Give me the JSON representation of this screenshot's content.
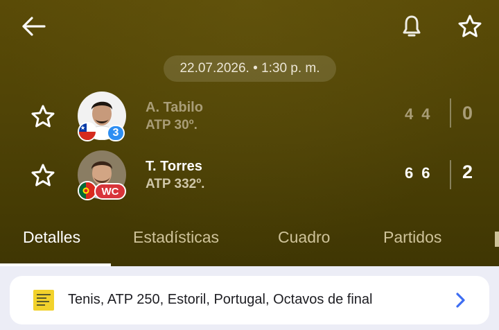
{
  "header": {
    "back_icon": "arrow-left-icon",
    "bell_icon": "bell-icon",
    "favorite_icon": "star-outline-icon"
  },
  "match": {
    "datetime": "22.07.2026. • 1:30 p. m."
  },
  "players": [
    {
      "name": "A. Tabilo",
      "rank": "ATP 30º.",
      "country_flag": "chile-flag-icon",
      "badge": "3",
      "set_scores": [
        "4",
        "4"
      ],
      "sets_won": "0",
      "status": "loser"
    },
    {
      "name": "T. Torres",
      "rank": "ATP 332º.",
      "country_flag": "portugal-flag-icon",
      "badge": "WC",
      "set_scores": [
        "6",
        "6"
      ],
      "sets_won": "2",
      "status": "winner"
    }
  ],
  "tabs": [
    {
      "label": "Detalles",
      "active": true
    },
    {
      "label": "Estadísticas",
      "active": false
    },
    {
      "label": "Cuadro",
      "active": false
    },
    {
      "label": "Partidos",
      "active": false
    }
  ],
  "tournament": {
    "label": "Tenis, ATP 250, Estoril, Portugal, Octavos de final",
    "icon": "tournament-logo-icon",
    "chevron_icon": "chevron-right-icon"
  },
  "colors": {
    "hero_bg": "#4f4306",
    "accent_blue": "#2d8ef2",
    "wc_red": "#d8343a",
    "page_bg": "#ecedf6"
  }
}
